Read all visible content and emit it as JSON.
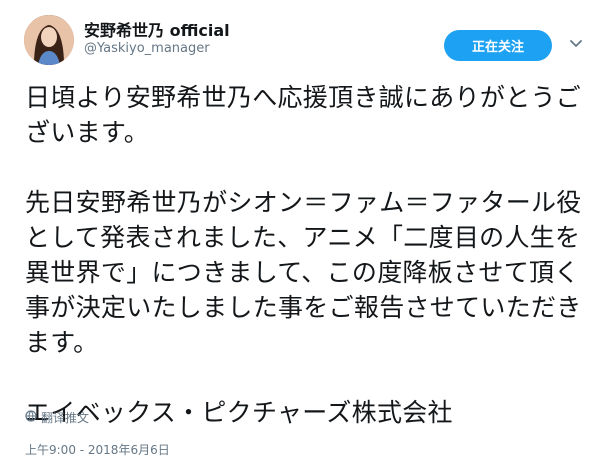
{
  "user": {
    "display_name": "安野希世乃 official",
    "screen_name": "@Yaskiyo_manager"
  },
  "follow_button": {
    "label": "正在关注"
  },
  "tweet": {
    "paragraphs": [
      "日頃より安野希世乃へ応援頂き誠にありがとうございます。",
      "先日安野希世乃がシオン＝ファム＝ファタール役として発表されました、アニメ「二度目の人生を異世界で」につきまして、この度降板させて頂く事が決定いたしました事をご報告させていただきます。",
      "エイベックス・ピクチャーズ株式会社"
    ]
  },
  "translate": {
    "label": "翻译推文",
    "icon": "globe-icon"
  },
  "timestamp": "上午9:00 - 2018年6月6日",
  "colors": {
    "accent": "#1da1f2",
    "secondary_text": "#657786"
  }
}
